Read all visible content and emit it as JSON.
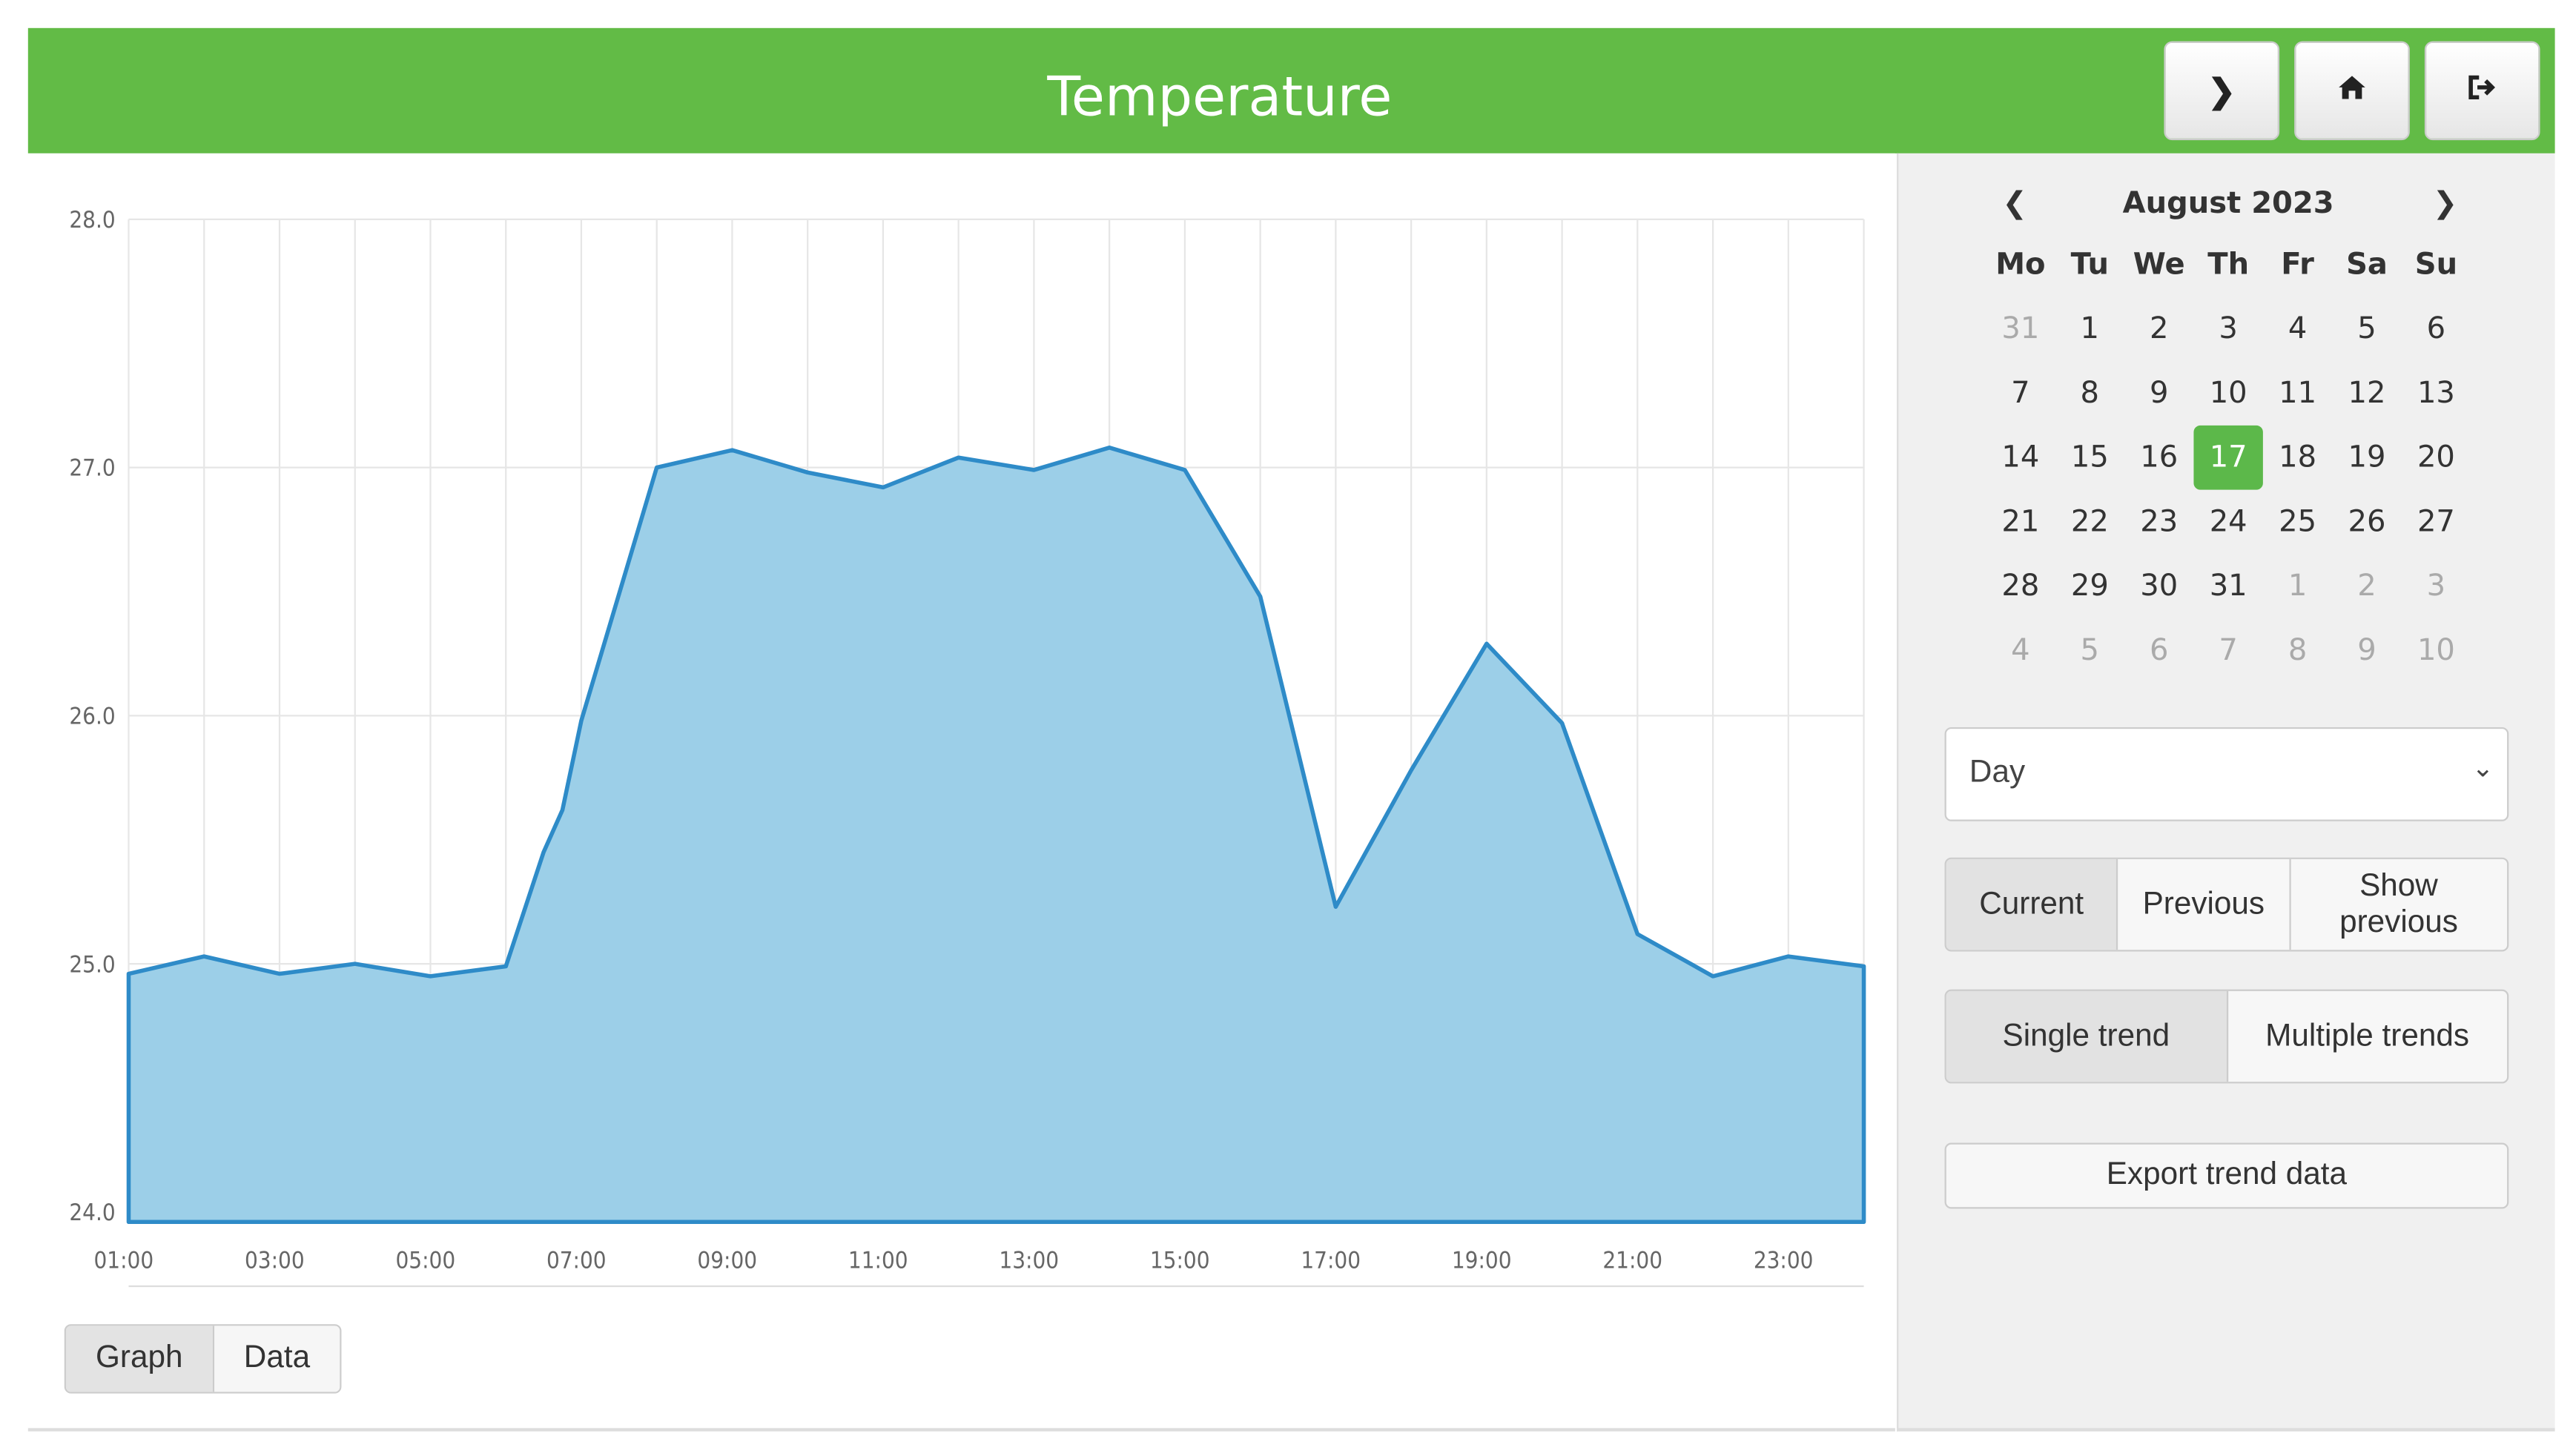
{
  "header": {
    "title": "Temperature",
    "buttons": [
      {
        "icon": "chevron-right-icon",
        "glyph": "❯"
      },
      {
        "icon": "home-icon",
        "glyph": "⌂"
      },
      {
        "icon": "logout-icon",
        "glyph": "⇥"
      }
    ],
    "color": "#62bb46"
  },
  "chart_data": {
    "type": "area",
    "x": [
      "01:00",
      "02:00",
      "03:00",
      "04:00",
      "05:00",
      "06:00",
      "06:30",
      "06:45",
      "07:00",
      "08:00",
      "09:00",
      "10:00",
      "11:00",
      "12:00",
      "13:00",
      "14:00",
      "15:00",
      "16:00",
      "17:00",
      "18:00",
      "19:00",
      "20:00",
      "21:00",
      "22:00",
      "23:00",
      "24:00"
    ],
    "values": [
      24.96,
      25.03,
      24.96,
      25.0,
      24.95,
      24.99,
      25.45,
      25.62,
      25.98,
      27.0,
      27.07,
      26.98,
      26.92,
      27.04,
      26.99,
      27.08,
      26.99,
      26.48,
      25.23,
      25.78,
      26.29,
      25.97,
      25.12,
      24.95,
      25.03,
      24.99
    ],
    "ylim": [
      24.0,
      28.0
    ],
    "yticks": [
      "24.0",
      "25.0",
      "26.0",
      "27.0",
      "28.0"
    ],
    "xticks": [
      "01:00",
      "03:00",
      "05:00",
      "07:00",
      "09:00",
      "11:00",
      "13:00",
      "15:00",
      "17:00",
      "19:00",
      "21:00",
      "23:00"
    ],
    "grid": true,
    "fill_color": "#9ccfe8",
    "line_color": "#2e8bc8"
  },
  "view_tabs": [
    {
      "label": "Graph",
      "active": true
    },
    {
      "label": "Data",
      "active": false
    }
  ],
  "calendar": {
    "month_label": "August 2023",
    "weekdays": [
      "Mo",
      "Tu",
      "We",
      "Th",
      "Fr",
      "Sa",
      "Su"
    ],
    "weeks": [
      [
        "31",
        "1",
        "2",
        "3",
        "4",
        "5",
        "6"
      ],
      [
        "7",
        "8",
        "9",
        "10",
        "11",
        "12",
        "13"
      ],
      [
        "14",
        "15",
        "16",
        "17",
        "18",
        "19",
        "20"
      ],
      [
        "21",
        "22",
        "23",
        "24",
        "25",
        "26",
        "27"
      ],
      [
        "28",
        "29",
        "30",
        "31",
        "1",
        "2",
        "3"
      ],
      [
        "4",
        "5",
        "6",
        "7",
        "8",
        "9",
        "10"
      ]
    ],
    "selected": "17",
    "selected_color": "#5cb84a"
  },
  "period_select": {
    "value": "Day"
  },
  "compare_buttons": [
    {
      "label": "Current",
      "active": true
    },
    {
      "label": "Previous",
      "active": false
    },
    {
      "label": "Show previous",
      "active": false
    }
  ],
  "trend_buttons": [
    {
      "label": "Single trend",
      "active": true
    },
    {
      "label": "Multiple trends",
      "active": false
    }
  ],
  "export_label": "Export trend data"
}
